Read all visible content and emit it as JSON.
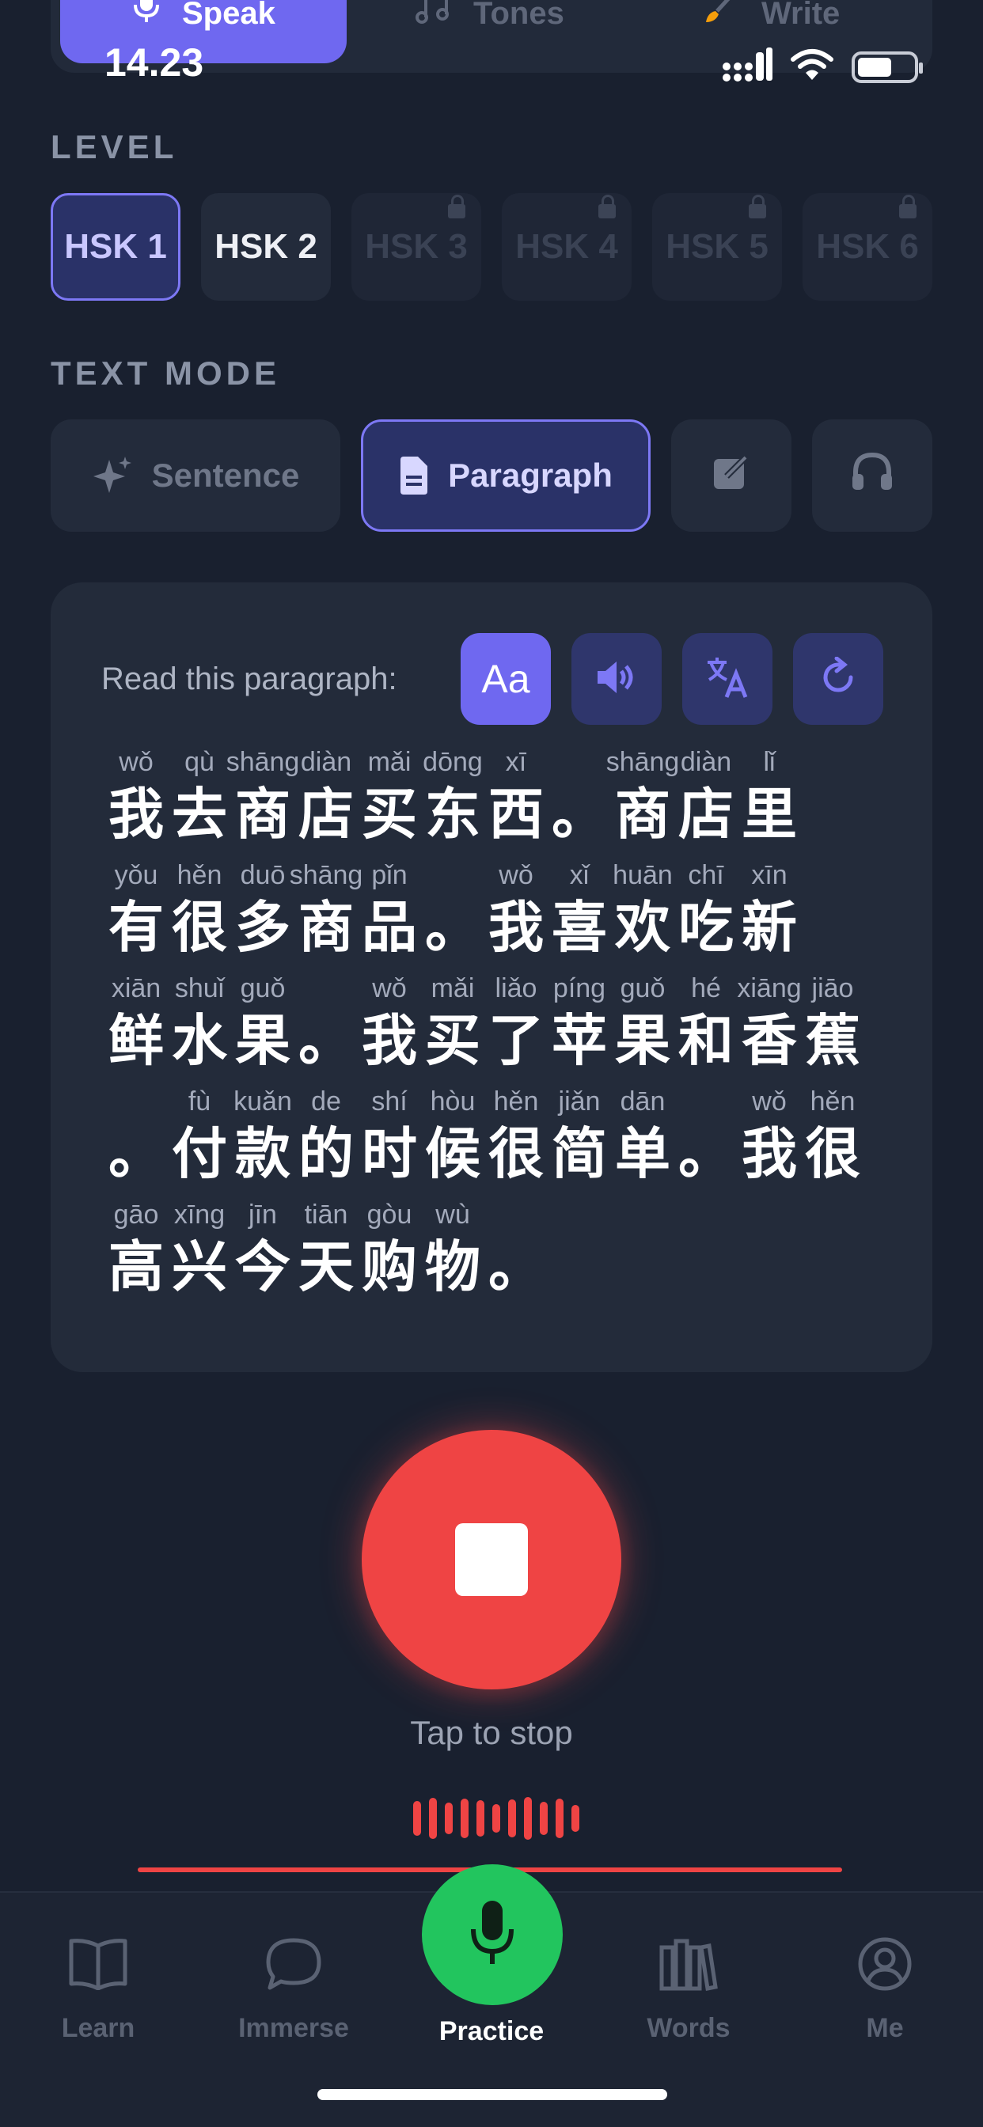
{
  "status": {
    "time": "14.23"
  },
  "modes": [
    {
      "label": "Speak",
      "icon": "mic-icon",
      "active": true
    },
    {
      "label": "Tones",
      "icon": "music-note-icon",
      "active": false
    },
    {
      "label": "Write",
      "icon": "brush-icon",
      "active": false
    }
  ],
  "level": {
    "label": "LEVEL",
    "items": [
      {
        "label": "HSK 1",
        "state": "active"
      },
      {
        "label": "HSK 2",
        "state": "available"
      },
      {
        "label": "HSK 3",
        "state": "locked"
      },
      {
        "label": "HSK 4",
        "state": "locked"
      },
      {
        "label": "HSK 5",
        "state": "locked"
      },
      {
        "label": "HSK 6",
        "state": "locked"
      }
    ]
  },
  "text_mode": {
    "label": "TEXT MODE",
    "sentence": "Sentence",
    "paragraph": "Paragraph"
  },
  "card": {
    "title": "Read this paragraph:",
    "font_button": "Aa",
    "lines": [
      [
        [
          "wǒ",
          "我"
        ],
        [
          "qù",
          "去"
        ],
        [
          "shāng",
          "商"
        ],
        [
          "diàn",
          "店"
        ],
        [
          "mǎi",
          "买"
        ],
        [
          "dōng",
          "东"
        ],
        [
          "xī",
          "西"
        ],
        [
          "",
          "。"
        ],
        [
          "shāng",
          "商"
        ],
        [
          "diàn",
          "店"
        ],
        [
          "lǐ",
          "里"
        ]
      ],
      [
        [
          "yǒu",
          "有"
        ],
        [
          "hěn",
          "很"
        ],
        [
          "duō",
          "多"
        ],
        [
          "shāng",
          "商"
        ],
        [
          "pǐn",
          "品"
        ],
        [
          "",
          "。"
        ],
        [
          "wǒ",
          "我"
        ],
        [
          "xǐ",
          "喜"
        ],
        [
          "huān",
          "欢"
        ],
        [
          "chī",
          "吃"
        ],
        [
          "xīn",
          "新"
        ]
      ],
      [
        [
          "xiān",
          "鲜"
        ],
        [
          "shuǐ",
          "水"
        ],
        [
          "guǒ",
          "果"
        ],
        [
          "",
          "。"
        ],
        [
          "wǒ",
          "我"
        ],
        [
          "mǎi",
          "买"
        ],
        [
          "liǎo",
          "了"
        ],
        [
          "píng",
          "苹"
        ],
        [
          "guǒ",
          "果"
        ],
        [
          "hé",
          "和"
        ],
        [
          "xiāng",
          "香"
        ],
        [
          "jiāo",
          "蕉"
        ]
      ],
      [
        [
          "",
          "。"
        ],
        [
          "fù",
          "付"
        ],
        [
          "kuǎn",
          "款"
        ],
        [
          "de",
          "的"
        ],
        [
          "shí",
          "时"
        ],
        [
          "hòu",
          "候"
        ],
        [
          "hěn",
          "很"
        ],
        [
          "jiǎn",
          "简"
        ],
        [
          "dān",
          "单"
        ],
        [
          "",
          "。"
        ],
        [
          "wǒ",
          "我"
        ],
        [
          "hěn",
          "很"
        ]
      ],
      [
        [
          "gāo",
          "高"
        ],
        [
          "xīng",
          "兴"
        ],
        [
          "jīn",
          "今"
        ],
        [
          "tiān",
          "天"
        ],
        [
          "gòu",
          "购"
        ],
        [
          "wù",
          "物"
        ],
        [
          "",
          "。"
        ]
      ]
    ]
  },
  "record": {
    "hint": "Tap to stop"
  },
  "nav": {
    "learn": "Learn",
    "immerse": "Immerse",
    "practice": "Practice",
    "words": "Words",
    "me": "Me"
  },
  "colors": {
    "accent": "#6f68f0",
    "record": "#ef4444",
    "practice": "#22c55e"
  }
}
